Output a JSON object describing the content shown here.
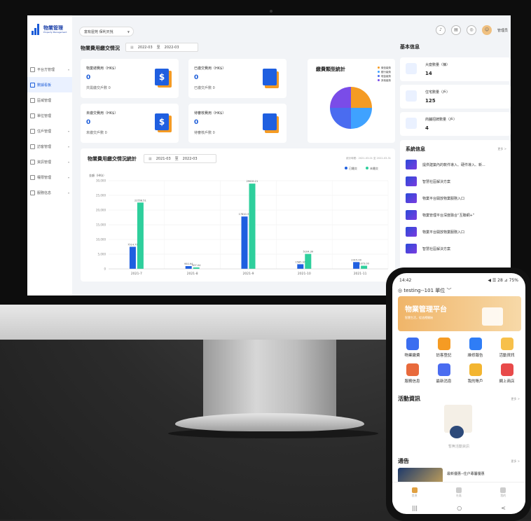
{
  "desktop": {
    "logo": {
      "title": "物業管理",
      "subtitle": "Property Management"
    },
    "community_select": "富有屋苑 保利天悅",
    "admin_label": "管理员",
    "menu": [
      {
        "label": "平台方管理"
      },
      {
        "label": "數據看板",
        "active": true
      },
      {
        "label": "區域管理"
      },
      {
        "label": "單位管理"
      },
      {
        "label": "住戶管理"
      },
      {
        "label": "訪客管理"
      },
      {
        "label": "資訊管理"
      },
      {
        "label": "權限管理"
      },
      {
        "label": "服務信息"
      }
    ],
    "fee_section": {
      "title": "物業費用繳交情況",
      "date_from": "2022-03",
      "date_sep": "至",
      "date_to": "2022-03"
    },
    "cards": [
      {
        "label": "物業總費用（HK$）",
        "value": "0",
        "sub": "共需繳交戶數 0"
      },
      {
        "label": "已繳交費用（HK$）",
        "value": "0",
        "sub": "已繳交戶數 0"
      },
      {
        "label": "未繳交費用（HK$）",
        "value": "0",
        "sub": "未繳交戶數 0"
      },
      {
        "label": "待審核費用（HK$）",
        "value": "0",
        "sub": "待審核戶數 0"
      }
    ],
    "pie": {
      "title": "繳費類型統計",
      "legend": [
        "微信繳費",
        "銀行繳費",
        "現金繳費",
        "其他繳費"
      ]
    },
    "chart_section": {
      "title": "物業費用繳交情況統計",
      "date_from": "2021-03",
      "date_sep": "至",
      "date_to": "2022-03",
      "range_text": "統計時間：2021-03-01 至 2022-03-31"
    },
    "basic_info": {
      "title": "基本信息",
      "items": [
        {
          "label": "大廈數量（棟）",
          "value": "14"
        },
        {
          "label": "住宅數量（戶）",
          "value": "125"
        },
        {
          "label": "商舖招牌數量（戶）",
          "value": "4"
        }
      ]
    },
    "system_info": {
      "title": "系統信息",
      "more": "更多 >",
      "items": [
        "提供建築內的軟件導入、硬件導入、新...",
        "智慧社區解決方案",
        "物業平台開放物業服務入口",
        "物業管理平台深度融合“互聯網+”",
        "物業平台開放物業服務入口",
        "智慧社區解決方案"
      ]
    }
  },
  "chart_data": {
    "type": "bar",
    "ylabel": "金額（HK$）",
    "ylim": [
      0,
      30000
    ],
    "yticks": [
      "0",
      "5,000",
      "10,000",
      "15,000",
      "20,000",
      "25,000",
      "30,000"
    ],
    "categories": [
      "2021-7",
      "2021-8",
      "2021-9",
      "2021-10",
      "2021-11"
    ],
    "series": [
      {
        "name": "已繳交",
        "color": "#1f5fe0",
        "values": [
          7514.77,
          950.94,
          17810.37,
          1585.97,
          2315.0
        ],
        "labels": [
          "7514.77",
          "950.94",
          "17810.37",
          "1585.97",
          "2315.00"
        ]
      },
      {
        "name": "未繳交",
        "color": "#2ecf9c",
        "values": [
          22558.51,
          507.04,
          29000.21,
          5104.39,
          1073.0
        ],
        "labels": [
          "22558.51",
          "507.04",
          "29000.21",
          "5104.39",
          "1073.00"
        ]
      }
    ],
    "legend_position": "top-right"
  },
  "mobile": {
    "status_time": "14:42",
    "status_right": "◀ ☰ 28 ⊿ 75%",
    "header": "testing--101 單位",
    "banner_title": "物業管理平台",
    "banner_sub": "智慧生活，從這裡開始",
    "grid": [
      "物業繳費",
      "訪客登記",
      "維修報告",
      "活動資訊",
      "服務信息",
      "最新消息",
      "我的賬戶",
      "網上商店"
    ],
    "activity_title": "活動資訊",
    "more": "更多 >",
    "empty_text": "暫無活動資訊",
    "notice_title": "通告",
    "notice_item": "最新優惠--住户專屬優惠",
    "tabs": [
      "首頁",
      "社區",
      "我的"
    ],
    "nav": [
      "|||",
      "○",
      "<"
    ]
  }
}
